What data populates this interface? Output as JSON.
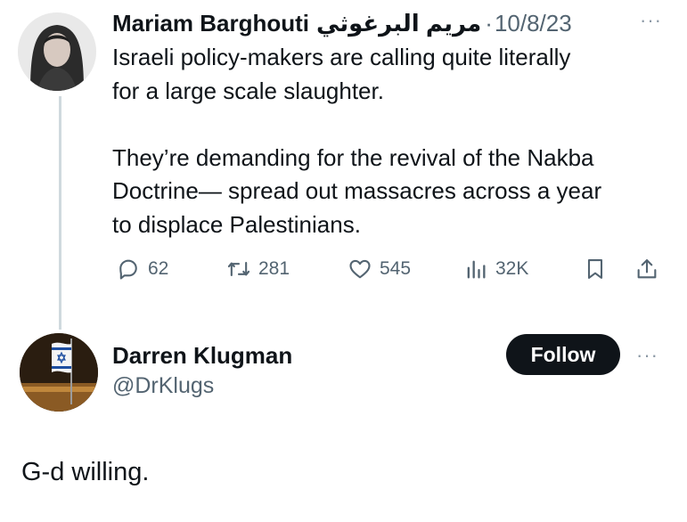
{
  "tweet1": {
    "display_name": "Mariam Barghouti",
    "display_name_rtl": "مريم البرغوثي",
    "separator": "·",
    "date": "10/8/23",
    "more": "···",
    "text": "Israeli policy-makers are calling quite literally\nfor a large scale slaughter.\n\nThey’re demanding for the revival of the Nakba\nDoctrine— spread out massacres across a year\nto displace Palestinians.",
    "actions": {
      "replies": "62",
      "reposts": "281",
      "likes": "545",
      "views": "32K"
    }
  },
  "tweet2": {
    "display_name": "Darren Klugman",
    "handle": "@DrKlugs",
    "follow_label": "Follow",
    "more": "···",
    "text": "G-d willing."
  },
  "colors": {
    "text": "#0f1419",
    "secondary": "#536471",
    "thread_line": "#cfd9de",
    "follow_bg": "#0f1419"
  },
  "icons": [
    "reply-icon",
    "repost-icon",
    "like-icon",
    "views-icon",
    "bookmark-icon",
    "share-icon",
    "more-icon"
  ]
}
